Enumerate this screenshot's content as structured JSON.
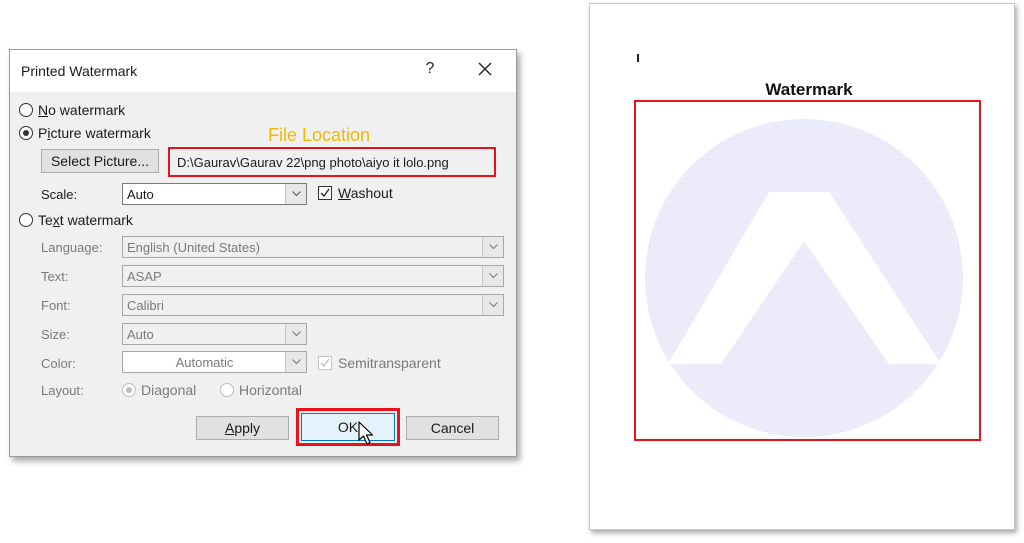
{
  "dialog": {
    "title": "Printed Watermark",
    "help_label": "?",
    "options": {
      "no_watermark": {
        "label": "No watermark",
        "accesskey": "N",
        "selected": false
      },
      "picture_watermark": {
        "label": "Picture watermark",
        "accesskey": "i",
        "selected": true
      },
      "text_watermark": {
        "label": "Text watermark",
        "accesskey": "x",
        "selected": false
      }
    },
    "select_picture_label": "Select Picture...",
    "picture_path": "D:\\Gaurav\\Gaurav 22\\png photo\\aiyo it lolo.png",
    "scale": {
      "label": "Scale:",
      "value": "Auto"
    },
    "washout": {
      "label": "Washout",
      "checked": true
    },
    "text_fields": {
      "language": {
        "label": "Language:",
        "value": "English (United States)"
      },
      "text": {
        "label": "Text:",
        "value": "ASAP"
      },
      "font": {
        "label": "Font:",
        "value": "Calibri"
      },
      "size": {
        "label": "Size:",
        "value": "Auto"
      },
      "color": {
        "label": "Color:",
        "value": "Automatic"
      },
      "semitransparent": {
        "label": "Semitransparent",
        "checked": true
      },
      "layout": {
        "label": "Layout:",
        "diagonal": "Diagonal",
        "horizontal": "Horizontal",
        "selected": "Diagonal"
      }
    },
    "buttons": {
      "apply": "Apply",
      "ok": "OK",
      "cancel": "Cancel"
    }
  },
  "annotations": {
    "file_location": "File Location"
  },
  "document": {
    "heading": "Watermark"
  },
  "colors": {
    "highlight_red": "#e8121b",
    "annotation_yellow": "#f5b800",
    "watermark_tint": "#ececfb"
  }
}
